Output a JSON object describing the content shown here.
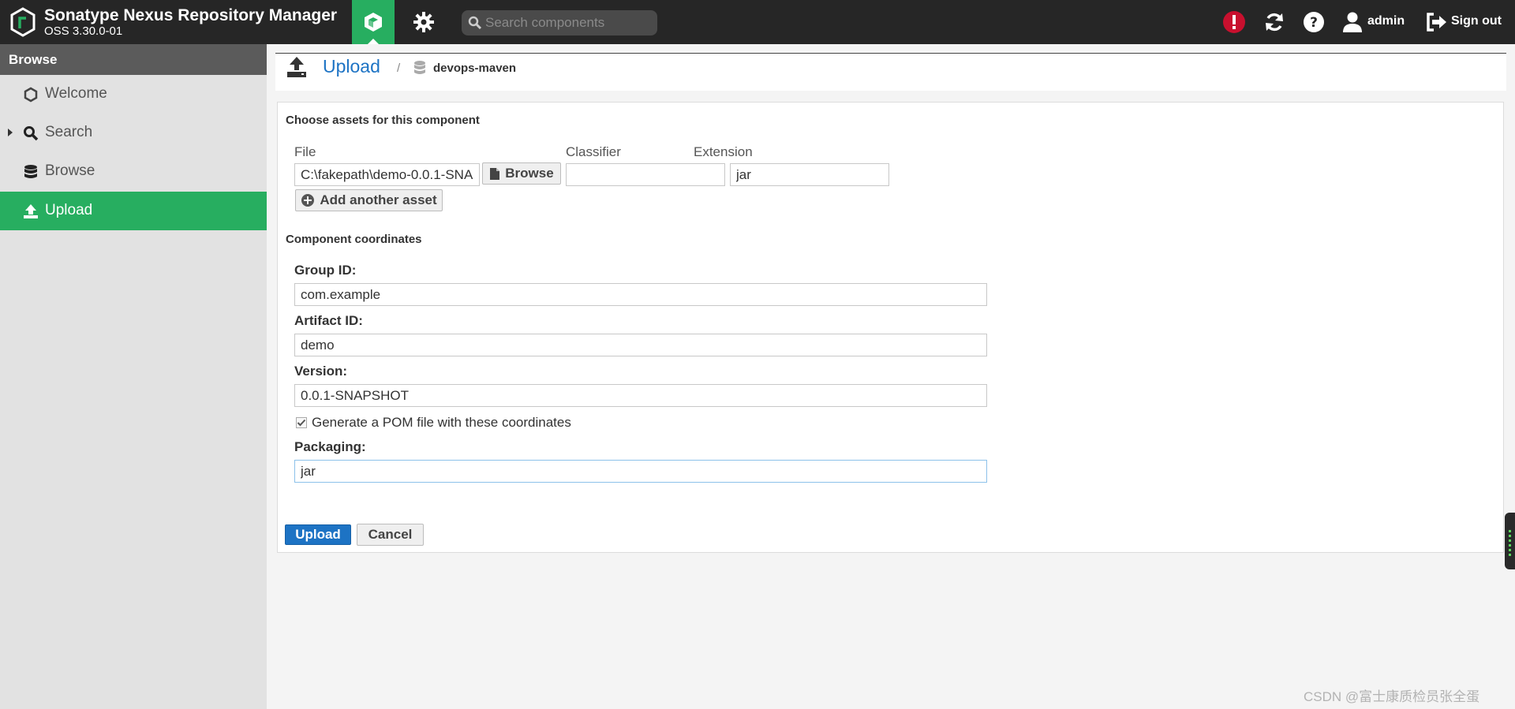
{
  "header": {
    "app_title": "Sonatype Nexus Repository Manager",
    "app_version": "OSS 3.30.0-01",
    "nav": [
      {
        "name": "browse-nav",
        "icon": "cube-icon",
        "active": true
      },
      {
        "name": "admin-nav",
        "icon": "gear-icon",
        "active": false
      }
    ],
    "search_placeholder": "Search components",
    "user_label": "admin",
    "signout_label": "Sign out",
    "alert_color": "#c8102e"
  },
  "sidebar": {
    "header": "Browse",
    "items": [
      {
        "label": "Welcome",
        "icon": "hexagon-icon",
        "active": false
      },
      {
        "label": "Search",
        "icon": "search-icon",
        "active": false,
        "expandable": true
      },
      {
        "label": "Browse",
        "icon": "database-icon",
        "active": false
      },
      {
        "label": "Upload",
        "icon": "upload-icon",
        "active": true
      }
    ]
  },
  "breadcrumb": {
    "title": "Upload",
    "separator": "/",
    "repository": "devops-maven"
  },
  "assets": {
    "section_title": "Choose assets for this component",
    "file_label": "File",
    "classifier_label": "Classifier",
    "extension_label": "Extension",
    "file_value": "C:\\fakepath\\demo-0.0.1-SNA",
    "browse_label": "Browse",
    "classifier_value": "",
    "extension_value": "jar",
    "add_asset_label": "Add another asset"
  },
  "coordinates": {
    "section_title": "Component coordinates",
    "group_id_label": "Group ID:",
    "group_id_value": "com.example",
    "artifact_id_label": "Artifact ID:",
    "artifact_id_value": "demo",
    "version_label": "Version:",
    "version_value": "0.0.1-SNAPSHOT",
    "generate_pom_label": "Generate a POM file with these coordinates",
    "generate_pom_checked": true,
    "packaging_label": "Packaging:",
    "packaging_value": "jar"
  },
  "actions": {
    "upload_label": "Upload",
    "cancel_label": "Cancel"
  },
  "colors": {
    "accent_green": "#27ae60",
    "link_blue": "#1d73c4",
    "header_bg": "#262626"
  },
  "watermark": "CSDN @富士康质检员张全蛋"
}
